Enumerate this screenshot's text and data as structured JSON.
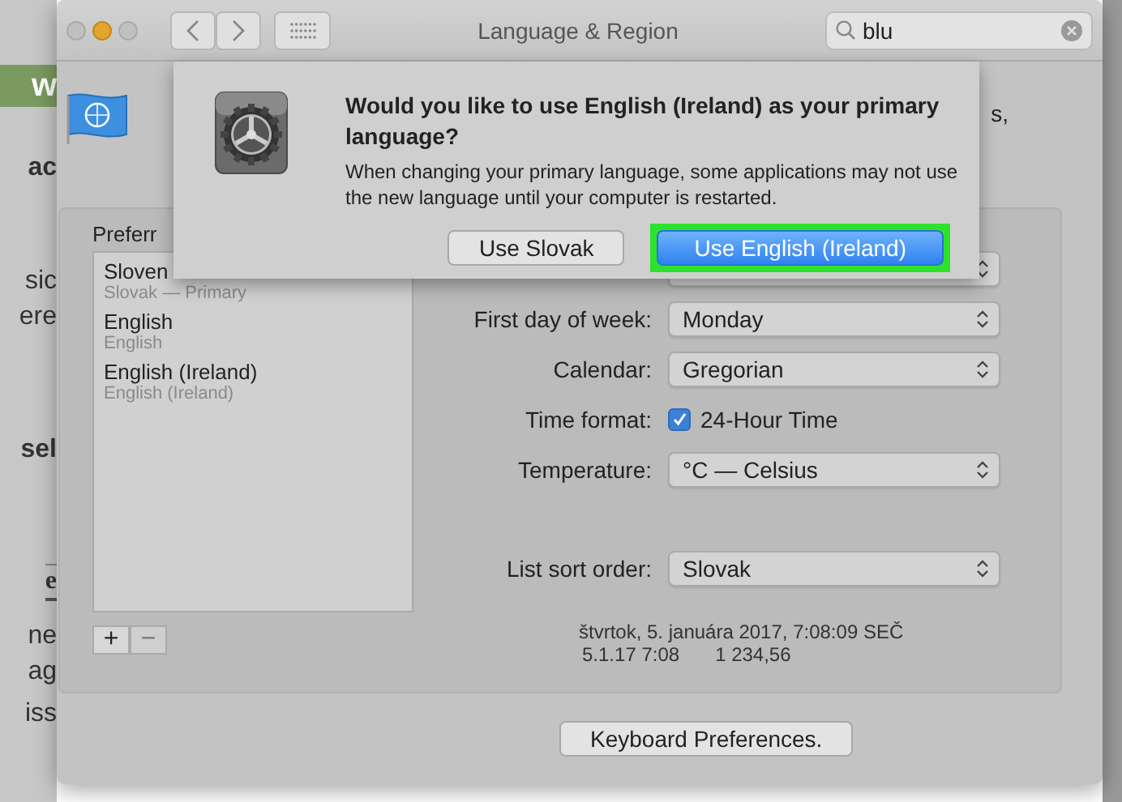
{
  "background_page": {
    "fragments": [
      {
        "text": "w",
        "kind": "banner"
      },
      {
        "text": "ac",
        "kind": "bold"
      },
      {
        "text": "sic",
        "kind": "plain"
      },
      {
        "text": "ere",
        "kind": "plain"
      },
      {
        "text": "sel",
        "kind": "bold"
      },
      {
        "text": "e",
        "kind": "boxed"
      },
      {
        "text": "ne",
        "kind": "plain"
      },
      {
        "text": "ag",
        "kind": "plain"
      },
      {
        "text": "iss",
        "kind": "plain"
      }
    ]
  },
  "window": {
    "title": "Language & Region",
    "search": {
      "value": "blu"
    }
  },
  "dialog": {
    "title": "Would you like to use English (Ireland) as your primary language?",
    "message": "When changing your primary language, some applications may not use the new language until your computer is restarted.",
    "buttons": [
      {
        "label": "Use Slovak",
        "default": false,
        "highlighted": false
      },
      {
        "label": "Use English (Ireland)",
        "default": true,
        "highlighted": true
      }
    ]
  },
  "hidden_text": "s,",
  "preferred_languages": {
    "label": "Preferr",
    "items": [
      {
        "name": "Sloven",
        "detail": "Slovak — Primary"
      },
      {
        "name": "English",
        "detail": "English"
      },
      {
        "name": "English (Ireland)",
        "detail": "English (Ireland)"
      }
    ]
  },
  "list_buttons": [
    {
      "label": "+",
      "disabled": false
    },
    {
      "label": "−",
      "disabled": true
    }
  ],
  "settings": [
    {
      "kind": "select"
    },
    {
      "kind": "select",
      "label": "First day of week:",
      "value": "Monday"
    },
    {
      "kind": "select",
      "label": "Calendar:",
      "value": "Gregorian"
    },
    {
      "kind": "checkbox",
      "label": "Time format:",
      "value": "24-Hour Time",
      "checked": true
    },
    {
      "kind": "select",
      "label": "Temperature:",
      "value": "°C — Celsius"
    },
    {
      "kind": "select",
      "label": "List sort order:",
      "value": "Slovak"
    }
  ],
  "sample": {
    "long_date": "štvrtok, 5. januára 2017, 7:08:09 SEČ",
    "short_date": "5.1.17 7:08",
    "number": "1 234,56"
  },
  "keyboard_button": "Keyboard Preferences."
}
